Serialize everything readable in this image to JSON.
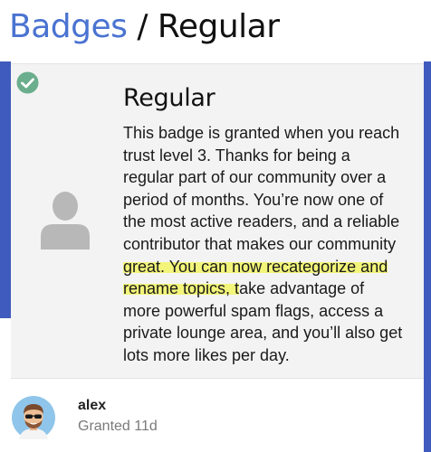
{
  "header": {
    "breadcrumb_link": "Badges",
    "separator": "/",
    "current": "Regular"
  },
  "badge": {
    "title": "Regular",
    "description_part1": "This badge is granted when you reach trust level 3. Thanks for being a regular part of our community over a period of months. You’re now one of the most active readers, and a reliable contributor that makes our community ",
    "description_highlight": "great. You can now recategorize and rename topics, t",
    "description_part2": "ake advantage of more powerful spam flags, access a private lounge area, and you’ll also get lots more likes per day.",
    "status_icon": "check-circle-icon",
    "badge_icon": "user-icon"
  },
  "grantee": {
    "username": "alex",
    "granted_text": "Granted 11d"
  },
  "colors": {
    "accent_blue": "#3f5bbd",
    "link_blue": "#4a73d1",
    "check_green": "#6aae8d",
    "highlight_yellow": "#f3f57a"
  }
}
